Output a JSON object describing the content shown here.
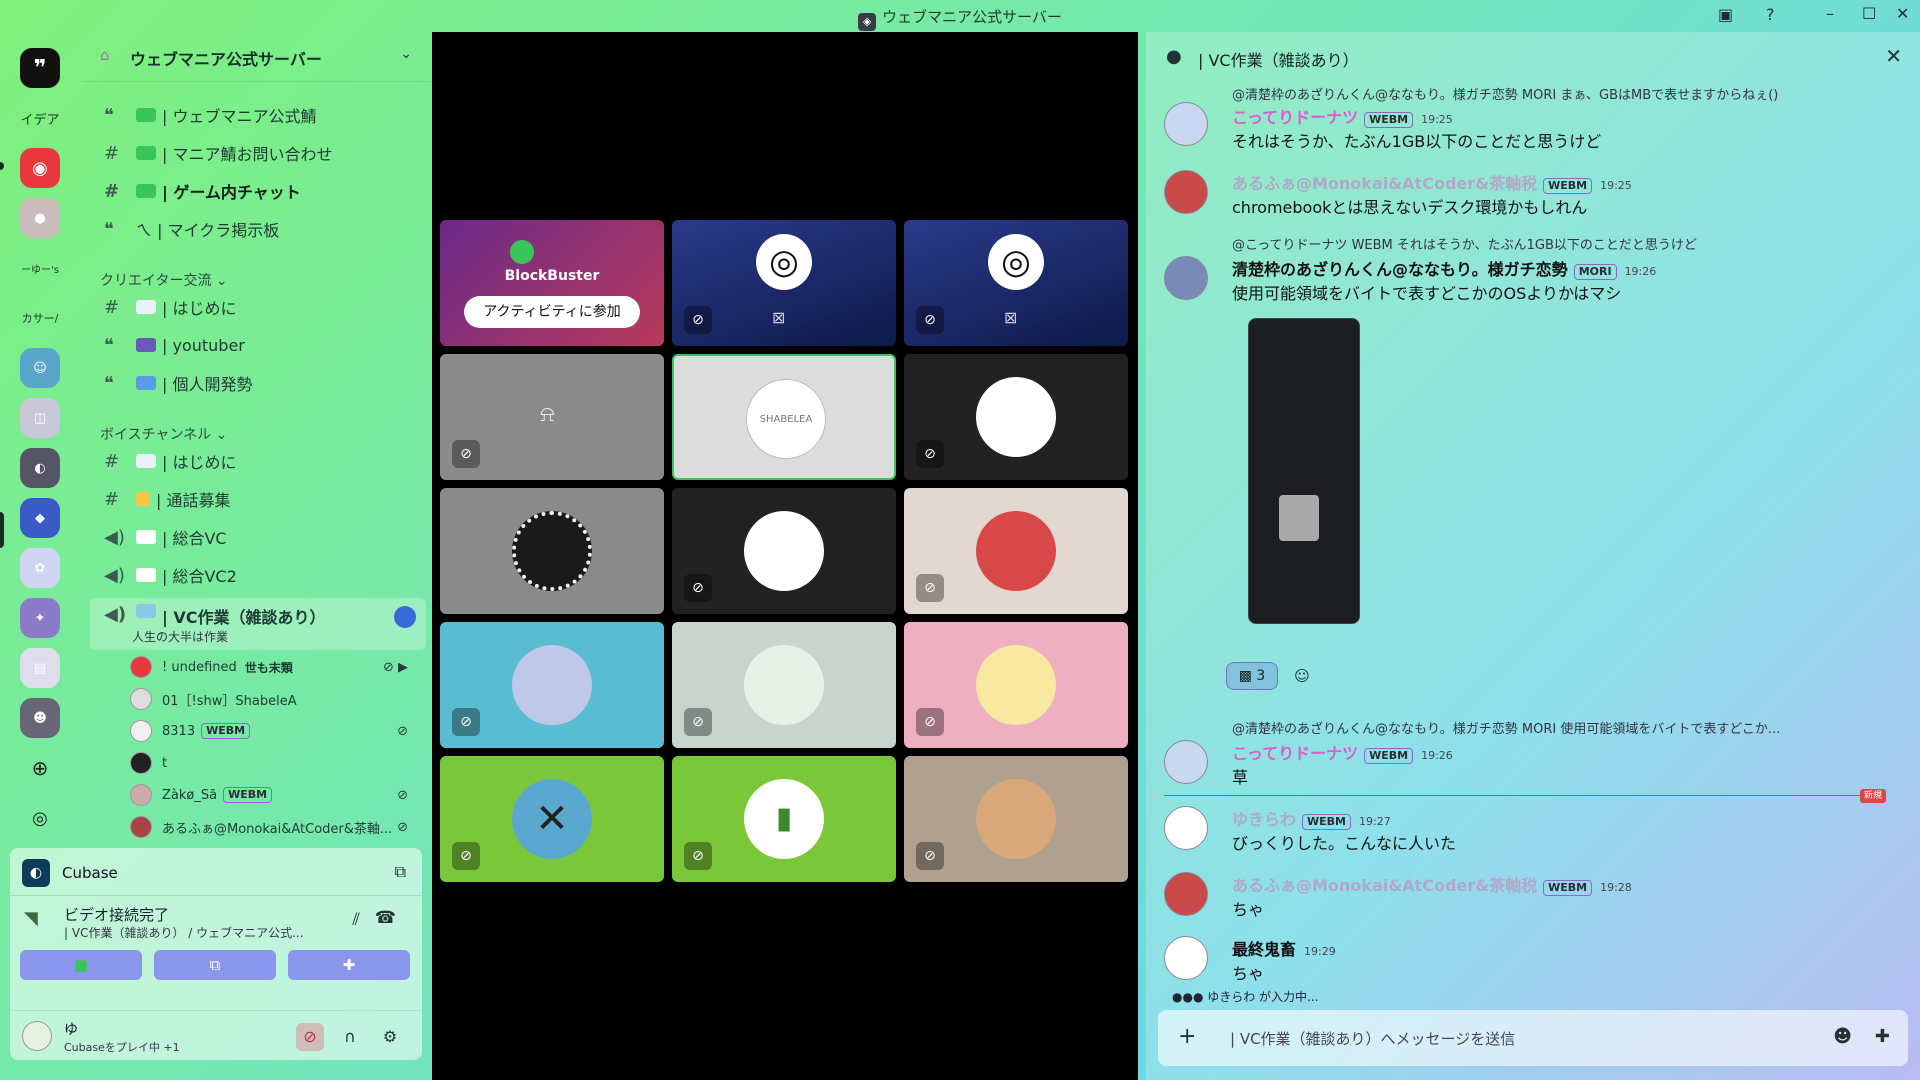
{
  "window": {
    "title": "ウェブマニア公式サーバー"
  },
  "rail": {
    "labels": [
      "イデア",
      "ーゆー's",
      "カサー/"
    ]
  },
  "sidebar": {
    "server_name": "ウェブマニア公式サーバー",
    "channels": [
      {
        "label": "| ウェブマニア公式鯖"
      },
      {
        "label": "| マニア鯖お問い合わせ"
      },
      {
        "label": "| ゲーム内チャット"
      },
      {
        "label": "ㄟ | マイクラ掲示板"
      }
    ],
    "cat_creator": "クリエイター交流 ⌄",
    "creator_channels": [
      {
        "label": "| はじめに"
      },
      {
        "label": "| youtuber"
      },
      {
        "label": "| 個人開発勢"
      }
    ],
    "cat_voice": "ボイスチャンネル ⌄",
    "voice_channels": [
      {
        "label": "| はじめに"
      },
      {
        "label": "| 通話募集"
      },
      {
        "label": "| 総合VC"
      },
      {
        "label": "| 総合VC2"
      }
    ],
    "selected_channel": {
      "label": "| VC作業（雑談あり）",
      "subtitle": "人生の大半は作業"
    },
    "voice_users": [
      {
        "name": "! undefined",
        "tag": "世も末類"
      },
      {
        "name": "01［!shw］ShabeleA",
        "tag": ""
      },
      {
        "name": "8313",
        "tag": "WEBM"
      },
      {
        "name": "t",
        "tag": ""
      },
      {
        "name": "Zàkø_Sã",
        "tag": "WEBM"
      },
      {
        "name": "あるふぁ@Monokai&AtCoder&茶軸...",
        "tag": ""
      }
    ]
  },
  "panel": {
    "activity": "Cubase",
    "voice_status": "ビデオ接続完了",
    "voice_channel": "| VC作業（雑談あり） / ウェブマニア公式...",
    "user_name": "ゆ",
    "user_status": "Cubaseをプレイ中 +1"
  },
  "stage": {
    "activity_title": "BlockBuster",
    "join_label": "アクティビティに参加",
    "shabelea": "SHABELEA"
  },
  "chat": {
    "title": "| VC作業（雑談あり）",
    "messages": [
      {
        "reply": "@清楚枠のあざりんくん@ななもり。様ガチ恋勢  MORI  まぁ、GBはMBで表せますからねぇ()",
        "author": "こってりドーナツ",
        "tag": "WEBM",
        "time": "19:25",
        "text": "それはそうか、たぶん1GB以下のことだと思うけど"
      },
      {
        "reply": "",
        "author": "あるふぁ@Monokai&AtCoder&茶軸税",
        "tag": "WEBM",
        "time": "19:25",
        "text": "chromebookとは思えないデスク環境かもしれん"
      },
      {
        "reply": "@こってりドーナツ  WEBM  それはそうか、たぶん1GB以下のことだと思うけど",
        "author": "清楚枠のあざりんくん@ななもり。様ガチ恋勢",
        "tag": "MORI",
        "time": "19:26",
        "text": "使用可能領域をバイトで表すどこかのOSよりかはマシ"
      },
      {
        "reply": "@清楚枠のあざりんくん@ななもり。様ガチ恋勢  MORI  使用可能領域をバイトで表すどこか...",
        "author": "こってりドーナツ",
        "tag": "WEBM",
        "time": "19:26",
        "text": "草"
      },
      {
        "reply": "",
        "author": "ゆきらわ",
        "tag": "WEBM",
        "time": "19:27",
        "text": "びっくりした。こんなに人いた"
      },
      {
        "reply": "",
        "author": "あるふぁ@Monokai&AtCoder&茶軸税",
        "tag": "WEBM",
        "time": "19:28",
        "text": "ちゃ"
      },
      {
        "reply": "",
        "author": "最終鬼畜",
        "tag": "",
        "time": "19:29",
        "text": "ちゃ"
      }
    ],
    "reaction_count": "3",
    "new_label": "新規",
    "typing": "ゆきらわ が入力中...",
    "composer_placeholder": "| VC作業（雑談あり）へメッセージを送信"
  },
  "colors": {
    "accent": "#8a96ec",
    "author_pink": "#e05ad0",
    "author_dim": "#b0a8c8",
    "new_red": "#e04444"
  }
}
